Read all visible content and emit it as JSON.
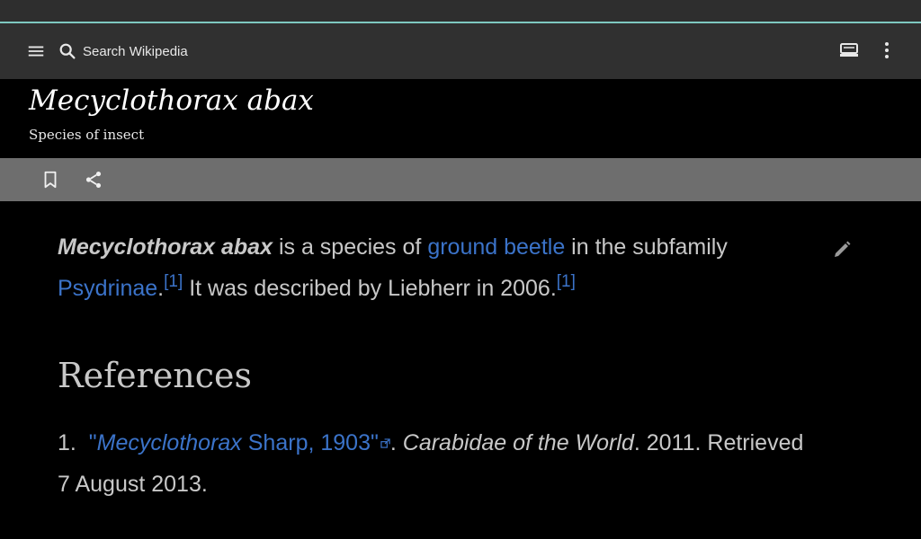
{
  "toolbar": {
    "search_placeholder": "Search Wikipedia",
    "icons": [
      "menu-icon",
      "search-icon",
      "reading-list-icon",
      "more-options-icon"
    ]
  },
  "article": {
    "title": "Mecyclothorax abax",
    "subtitle": "Species of insect",
    "actions": [
      "bookmark-icon",
      "share-icon"
    ],
    "lead": {
      "bold_title": "Mecyclothorax abax",
      "text1": " is a species of ",
      "link1": "ground beetle",
      "text2": " in the subfamily ",
      "link2": "Psydrinae",
      "text3": ".",
      "ref1": "[1]",
      "text4": " It was described by Liebherr in 2006.",
      "ref2": "[1]"
    },
    "references": {
      "heading": "References",
      "items": [
        {
          "number": "1.",
          "quote_open": "\"",
          "link_italic": "Mecyclothorax",
          "link_rest": " Sharp, 1903",
          "quote_close": "\"",
          "after_link": ". ",
          "source_italic": "Carabidae of the World",
          "rest": ". 2011. Retrieved 7 August 2013."
        }
      ]
    }
  },
  "colors": {
    "background": "#000000",
    "toolbar": "#303030",
    "action_bar": "#6e6e6e",
    "accent_line": "#7ec8c0",
    "link": "#3b73c9",
    "body_text": "#c8c8c8"
  }
}
